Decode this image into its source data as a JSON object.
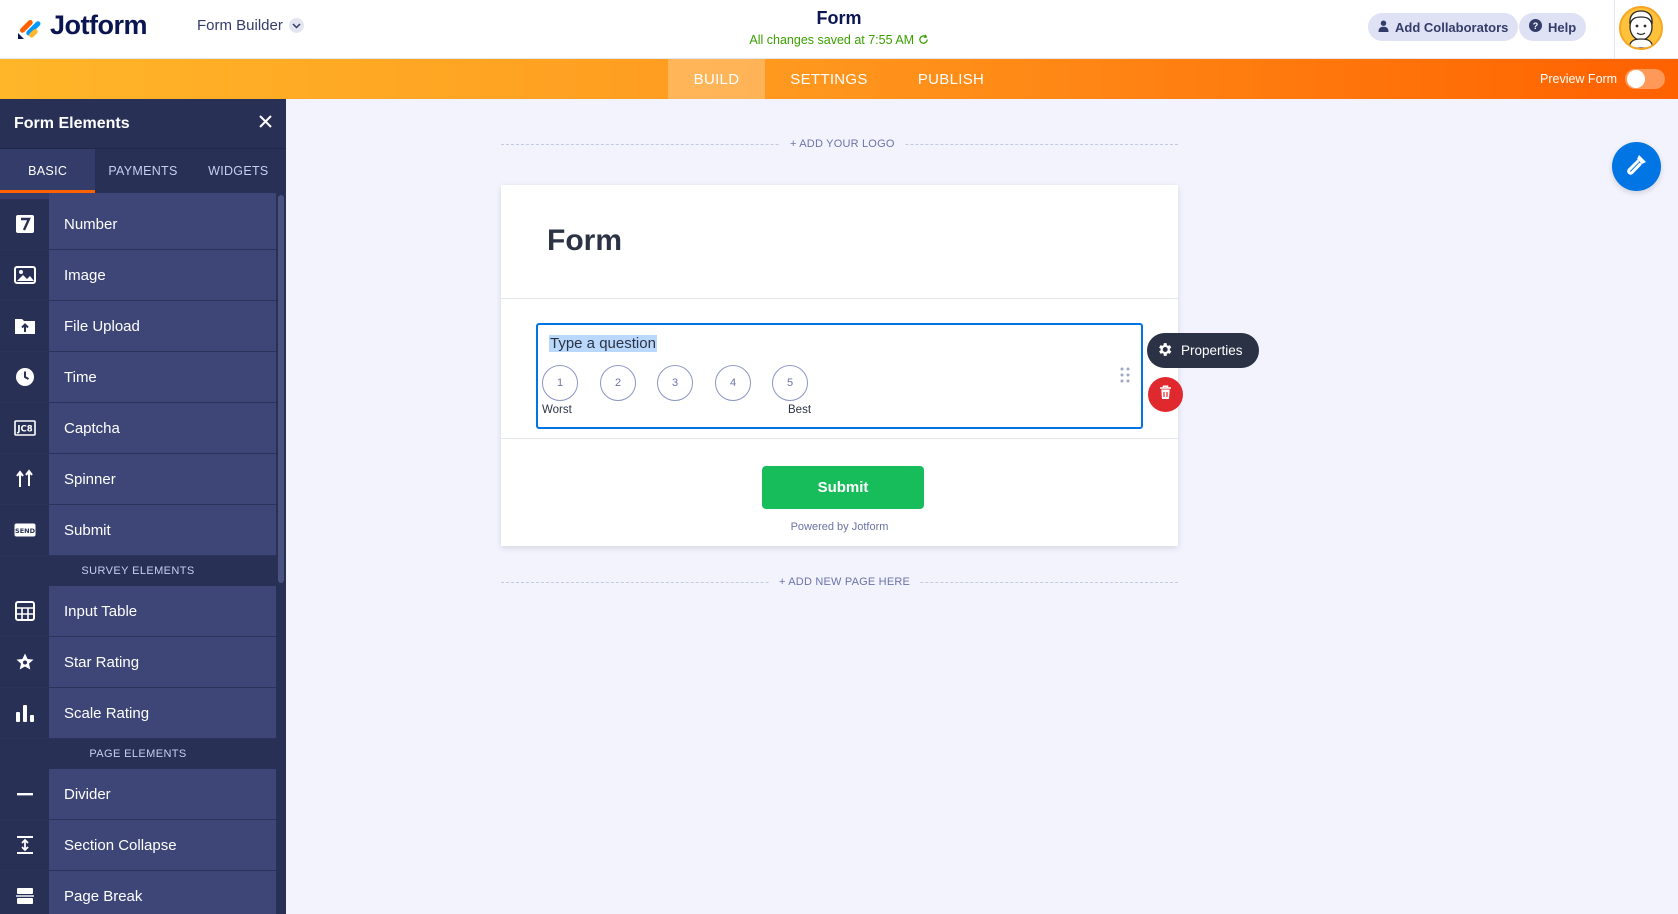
{
  "header": {
    "brand": "Jotform",
    "builder_selector": "Form Builder",
    "form_title": "Form",
    "save_status": "All changes saved at 7:55 AM",
    "add_collaborators": "Add Collaborators",
    "help": "Help"
  },
  "nav": {
    "tabs": [
      {
        "label": "BUILD",
        "active": true
      },
      {
        "label": "SETTINGS",
        "active": false
      },
      {
        "label": "PUBLISH",
        "active": false
      }
    ],
    "preview_label": "Preview Form",
    "preview_enabled": false
  },
  "sidebar": {
    "title": "Form Elements",
    "tabs": [
      {
        "label": "BASIC",
        "active": true
      },
      {
        "label": "PAYMENTS",
        "active": false
      },
      {
        "label": "WIDGETS",
        "active": false
      }
    ],
    "basic_items": [
      {
        "label": "Number",
        "icon": "number-seven-icon"
      },
      {
        "label": "Image",
        "icon": "image-icon"
      },
      {
        "label": "File Upload",
        "icon": "folder-upload-icon"
      },
      {
        "label": "Time",
        "icon": "clock-icon"
      },
      {
        "label": "Captcha",
        "icon": "captcha-icon"
      },
      {
        "label": "Spinner",
        "icon": "spinner-arrows-icon"
      },
      {
        "label": "Submit",
        "icon": "send-icon"
      }
    ],
    "survey_section": "SURVEY ELEMENTS",
    "survey_items": [
      {
        "label": "Input Table",
        "icon": "table-icon"
      },
      {
        "label": "Star Rating",
        "icon": "star-icon"
      },
      {
        "label": "Scale Rating",
        "icon": "bar-chart-icon"
      }
    ],
    "page_section": "PAGE ELEMENTS",
    "page_items": [
      {
        "label": "Divider",
        "icon": "divider-icon"
      },
      {
        "label": "Section Collapse",
        "icon": "section-collapse-icon"
      },
      {
        "label": "Page Break",
        "icon": "page-break-icon"
      }
    ]
  },
  "canvas": {
    "add_logo": "+ ADD YOUR LOGO",
    "form_heading": "Form",
    "question_placeholder": "Type a question",
    "scale": [
      "1",
      "2",
      "3",
      "4",
      "5"
    ],
    "scale_low": "Worst",
    "scale_high": "Best",
    "submit_label": "Submit",
    "powered_by": "Powered by Jotform",
    "add_page": "+ ADD NEW PAGE HERE",
    "properties_label": "Properties"
  },
  "colors": {
    "accent_orange": "#ff6100",
    "nav_gradient_start": "#ffb629",
    "sidebar_bg": "#343c6a",
    "submit_green": "#18bd5b",
    "selection_blue": "#0075e3",
    "delete_red": "#e0282f",
    "saved_green": "#3aa000"
  }
}
